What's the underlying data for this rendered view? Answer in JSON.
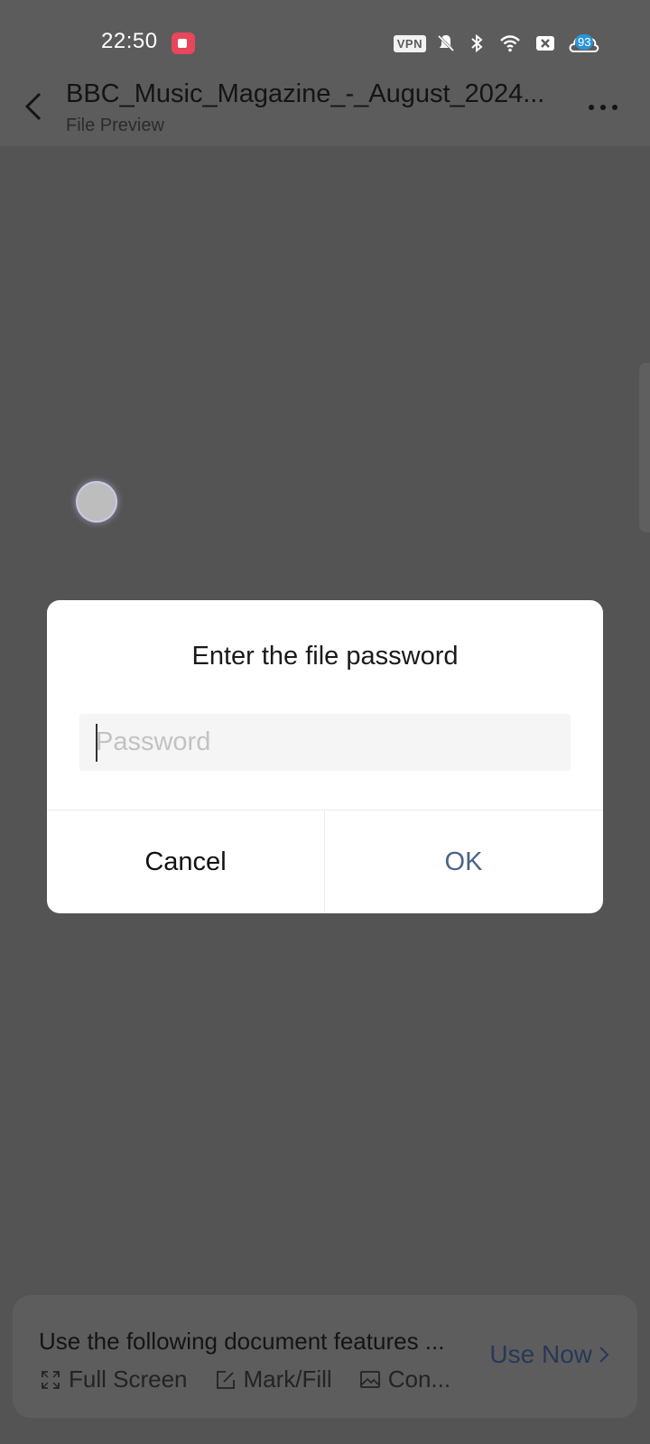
{
  "status_bar": {
    "time": "22:50",
    "vpn_label": "VPN",
    "battery": "93",
    "icons": [
      "screen-record-icon",
      "vpn-icon",
      "mute-icon",
      "bluetooth-icon",
      "wifi-icon",
      "sim-off-icon",
      "battery-cloud-icon"
    ]
  },
  "header": {
    "title": "BBC_Music_Magazine_-_August_2024...",
    "subtitle": "File Preview"
  },
  "dialog": {
    "title": "Enter the file password",
    "password_placeholder": "Password",
    "password_value": "",
    "cancel_label": "Cancel",
    "ok_label": "OK"
  },
  "promo": {
    "text": "Use the following document features ...",
    "features": [
      {
        "label": "Full Screen",
        "icon": "fullscreen-icon"
      },
      {
        "label": "Mark/Fill",
        "icon": "edit-icon"
      },
      {
        "label": "Con...",
        "icon": "image-icon"
      }
    ],
    "action_label": "Use Now"
  },
  "colors": {
    "overlay_bg": "#545454",
    "ok_text": "#4a6389",
    "use_now_text": "#283858"
  }
}
